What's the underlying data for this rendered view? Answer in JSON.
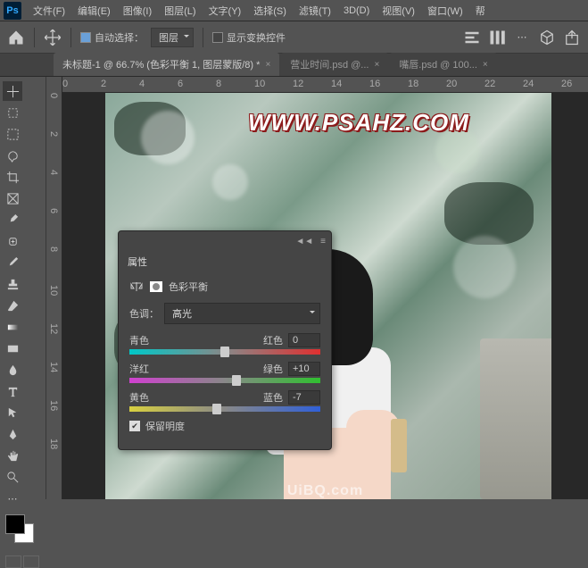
{
  "menu": {
    "items": [
      "文件(F)",
      "编辑(E)",
      "图像(I)",
      "图层(L)",
      "文字(Y)",
      "选择(S)",
      "滤镜(T)",
      "3D(D)",
      "视图(V)",
      "窗口(W)",
      "帮"
    ]
  },
  "optbar": {
    "auto_select": "自动选择：",
    "auto_select_dd": "图层",
    "show_transform": "显示变换控件"
  },
  "tabs": [
    {
      "label": "未标题-1 @ 66.7% (色彩平衡 1, 图层蒙版/8) *",
      "active": true
    },
    {
      "label": "营业时间.psd @... ",
      "active": false
    },
    {
      "label": "嘴唇.psd @ 100... ",
      "active": false
    }
  ],
  "ruler_h": [
    "0",
    "2",
    "4",
    "6",
    "8",
    "10",
    "12",
    "14",
    "16",
    "18",
    "20",
    "22",
    "24",
    "26"
  ],
  "ruler_v": [
    "0",
    "2",
    "4",
    "6",
    "8",
    "10",
    "12",
    "14",
    "16",
    "18"
  ],
  "watermark": "WWW.PSAHZ.COM",
  "footer_wm": "UiBQ.com",
  "panel": {
    "tab": "属性",
    "title": "色彩平衡",
    "tone_label": "色调：",
    "tone_value": "高光",
    "sliders": [
      {
        "left": "青色",
        "right": "红色",
        "value": "0",
        "pos": 50,
        "grad": "grad-cr"
      },
      {
        "left": "洋红",
        "right": "绿色",
        "value": "+10",
        "pos": 56,
        "grad": "grad-mg"
      },
      {
        "left": "黄色",
        "right": "蓝色",
        "value": "-7",
        "pos": 46,
        "grad": "grad-yb"
      }
    ],
    "preserve": "保留明度"
  }
}
